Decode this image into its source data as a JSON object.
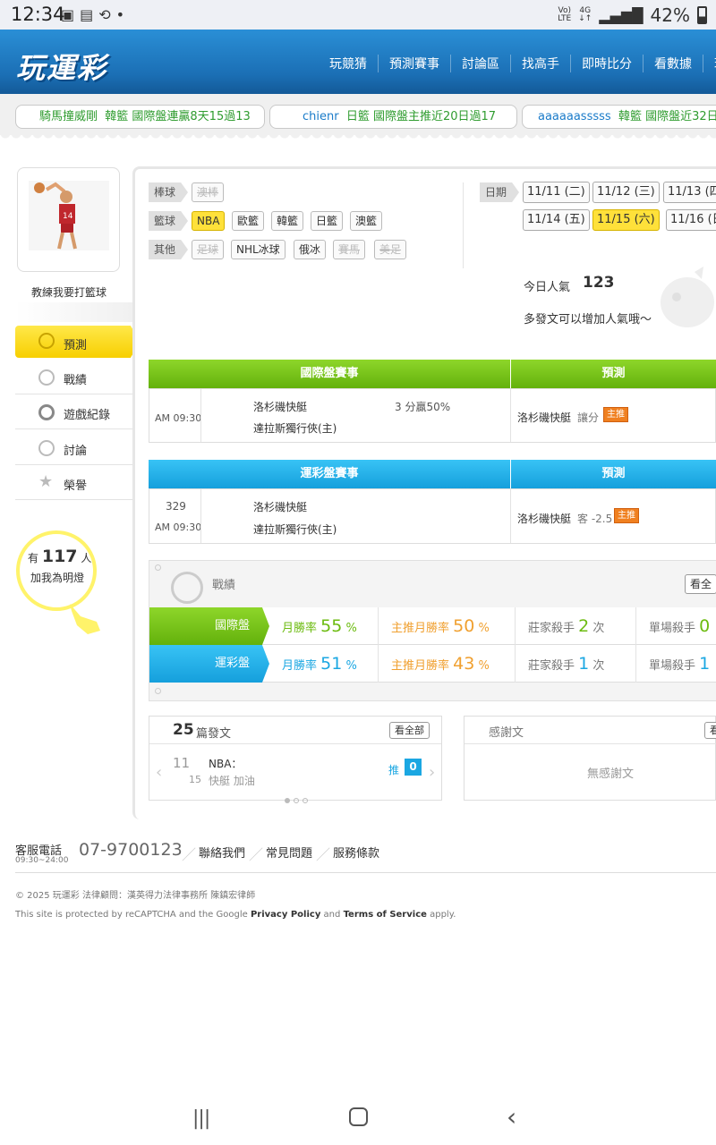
{
  "status": {
    "time": "12:34",
    "volte": "Vo) LTE",
    "net": "4G",
    "battery": "42%"
  },
  "header": {
    "logo": "玩運彩",
    "nav": [
      "玩競猜",
      "預測賽事",
      "討論區",
      "找高手",
      "即時比分",
      "看數據",
      "玩"
    ]
  },
  "ticker": [
    {
      "user": "騎馬撞威剛",
      "text": "韓籃 國際盤連贏8天15過13"
    },
    {
      "user": "chienr",
      "text": "日籃 國際盤主推近20日過17"
    },
    {
      "user": "aaaaaasssss",
      "text": "韓籃 國際盤近32日-"
    }
  ],
  "profile": {
    "name": "教練我要打籃球",
    "fans_prefix": "有",
    "fans_count": "117",
    "fans_unit": "人",
    "fans_cta": "加我為明燈"
  },
  "menu": [
    {
      "label": "預測",
      "icon": "target-icon"
    },
    {
      "label": "戰績",
      "icon": "record-icon"
    },
    {
      "label": "遊戲紀錄",
      "icon": "game-record-icon"
    },
    {
      "label": "討論",
      "icon": "discuss-icon"
    },
    {
      "label": "榮譽",
      "icon": "honor-icon"
    }
  ],
  "filters": {
    "baseball": {
      "label": "棒球",
      "items": [
        "澳棒"
      ]
    },
    "basketball": {
      "label": "籃球",
      "items": [
        "NBA",
        "歐籃",
        "韓籃",
        "日籃",
        "澳籃"
      ]
    },
    "other": {
      "label": "其他",
      "items": [
        "足球",
        "NHL冰球",
        "俄冰",
        "賽馬",
        "美足"
      ]
    }
  },
  "dates": {
    "label": "日期",
    "row1": [
      "11/11 (二)",
      "11/12 (三)",
      "11/13 (四"
    ],
    "row2": [
      "11/14 (五)",
      "11/15 (六)",
      "11/16 (日"
    ]
  },
  "popularity": {
    "label": "今日人氣",
    "value": "123",
    "hint": "多發文可以增加人氣哦～"
  },
  "intl_table": {
    "col1": "國際盤賽事",
    "col2": "預測",
    "time": "AM 09:30",
    "away": "洛杉磯快艇",
    "home": "達拉斯獨行俠(主)",
    "line": "3 分贏50%",
    "pick_team": "洛杉磯快艇",
    "pick_type": "讓分",
    "badge": "主推"
  },
  "lottery_table": {
    "col1": "運彩盤賽事",
    "col2": "預測",
    "no": "329",
    "time": "AM 09:30",
    "away": "洛杉磯快艇",
    "home": "達拉斯獨行俠(主)",
    "pick_team": "洛杉磯快艇",
    "pick_type": "客 -2.5",
    "badge": "主推"
  },
  "record": {
    "title": "戰績",
    "view_all": "看全",
    "rows": [
      {
        "label": "國際盤",
        "month_label": "月勝率",
        "month": "55",
        "push_label": "主推月勝率",
        "push": "50",
        "pct": "%",
        "killer_label": "莊家殺手",
        "killer": "2",
        "times": "次",
        "single_label": "單場殺手",
        "single": "0"
      },
      {
        "label": "運彩盤",
        "month_label": "月勝率",
        "month": "51",
        "push_label": "主推月勝率",
        "push": "43",
        "pct": "%",
        "killer_label": "莊家殺手",
        "killer": "1",
        "times": "次",
        "single_label": "單場殺手",
        "single": "1"
      }
    ]
  },
  "posts": {
    "count": "25",
    "label": "篇發文",
    "view_all": "看全部",
    "day": "11",
    "date_sub": "15",
    "title": "NBA：",
    "subtitle": "快艇 加油",
    "push_label": "推",
    "push_count": "0"
  },
  "thanks": {
    "title": "感謝文",
    "view_all": "看",
    "empty": "無感謝文"
  },
  "footer": {
    "phone_label": "客服電話",
    "phone_hours": "09:30~24:00",
    "phone": "07-9700123",
    "links": [
      "聯絡我們",
      "常見問題",
      "服務條款"
    ],
    "copyright": "© 2025 玩運彩 法律顧問：漢英得力法律事務所 陳鎮宏律師",
    "recaptcha_pre": "This site is protected by reCAPTCHA and the Google",
    "privacy": "Privacy Policy",
    "and": "and",
    "terms": "Terms of Service",
    "apply": "apply."
  },
  "colors": {
    "green": "#7ac81e",
    "blue": "#1ba7e2",
    "yellow": "#ffe13a",
    "orange": "#f08020"
  }
}
